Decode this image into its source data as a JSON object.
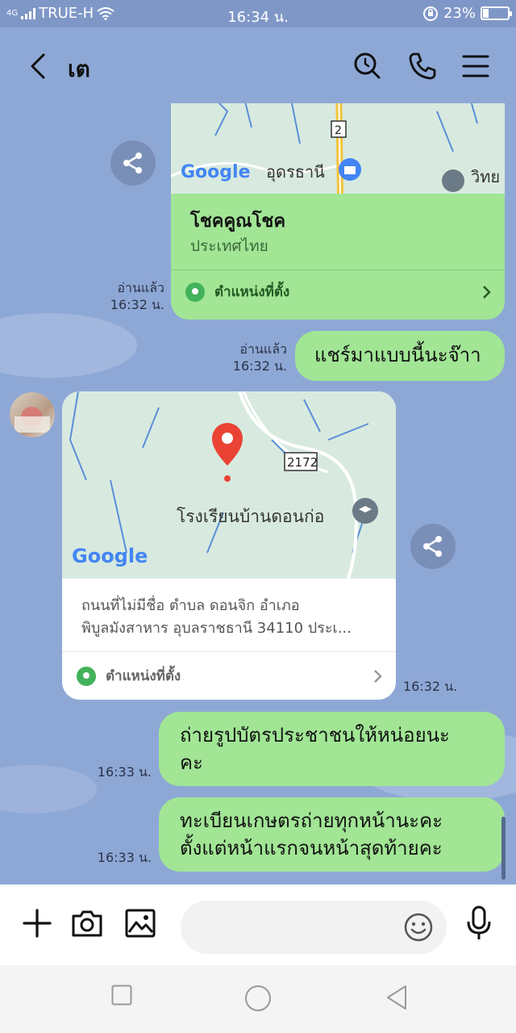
{
  "status_bar": {
    "network": "4G",
    "carrier": "TRUE-H",
    "time": "16:34 น.",
    "battery_percent": "23%",
    "battery_level": 0.23
  },
  "header": {
    "title": "เต",
    "icons": [
      "back-icon",
      "search-icon",
      "phone-icon",
      "menu-icon"
    ]
  },
  "chat": {
    "msg1": {
      "place_name": "โชคคูณโชค",
      "country": "ประเทศไทย",
      "map_label": "อุดรธานี",
      "map_label2": "วิทย",
      "road": "2",
      "location_label": "ตำแหน่งที่ตั้ง",
      "read_status": "อ่านแล้ว",
      "time": "16:32 น."
    },
    "msg2": {
      "text": "แชร์มาแบบนี้นะจ๊าา",
      "read_status": "อ่านแล้ว",
      "time": "16:32 น."
    },
    "msg3": {
      "map_label": "โรงเรียนบ้านดอนก่อ",
      "road": "2172",
      "address_line1": "ถนนที่ไม่มีชื่อ ตำบล ดอนจิก อำเภอ",
      "address_line2": "พิบูลมังสาหาร อุบลราชธานี 34110 ประเ...",
      "location_label": "ตำแหน่งที่ตั้ง",
      "time": "16:32 น."
    },
    "msg4": {
      "line1": "ถ่ายรูปบัตรประชาชนให้หน่อยนะ",
      "line2": "คะ",
      "time": "16:33 น."
    },
    "msg5": {
      "line1": "ทะเบียนเกษตรถ่ายทุกหน้านะคะ",
      "line2": "ตั้งแต่หน้าแรกจนหน้าสุดท้ายคะ",
      "time": "16:33 น."
    },
    "google_logo": "Google"
  },
  "input_bar": {
    "placeholder": "",
    "icons": [
      "plus-icon",
      "camera-icon",
      "image-icon",
      "emoji-icon",
      "mic-icon"
    ]
  },
  "colors": {
    "chat_bg": "#8ea8d6",
    "bubble_green": "#a1e595",
    "location_green": "#42b25b",
    "map_bg": "#d8eadf"
  }
}
